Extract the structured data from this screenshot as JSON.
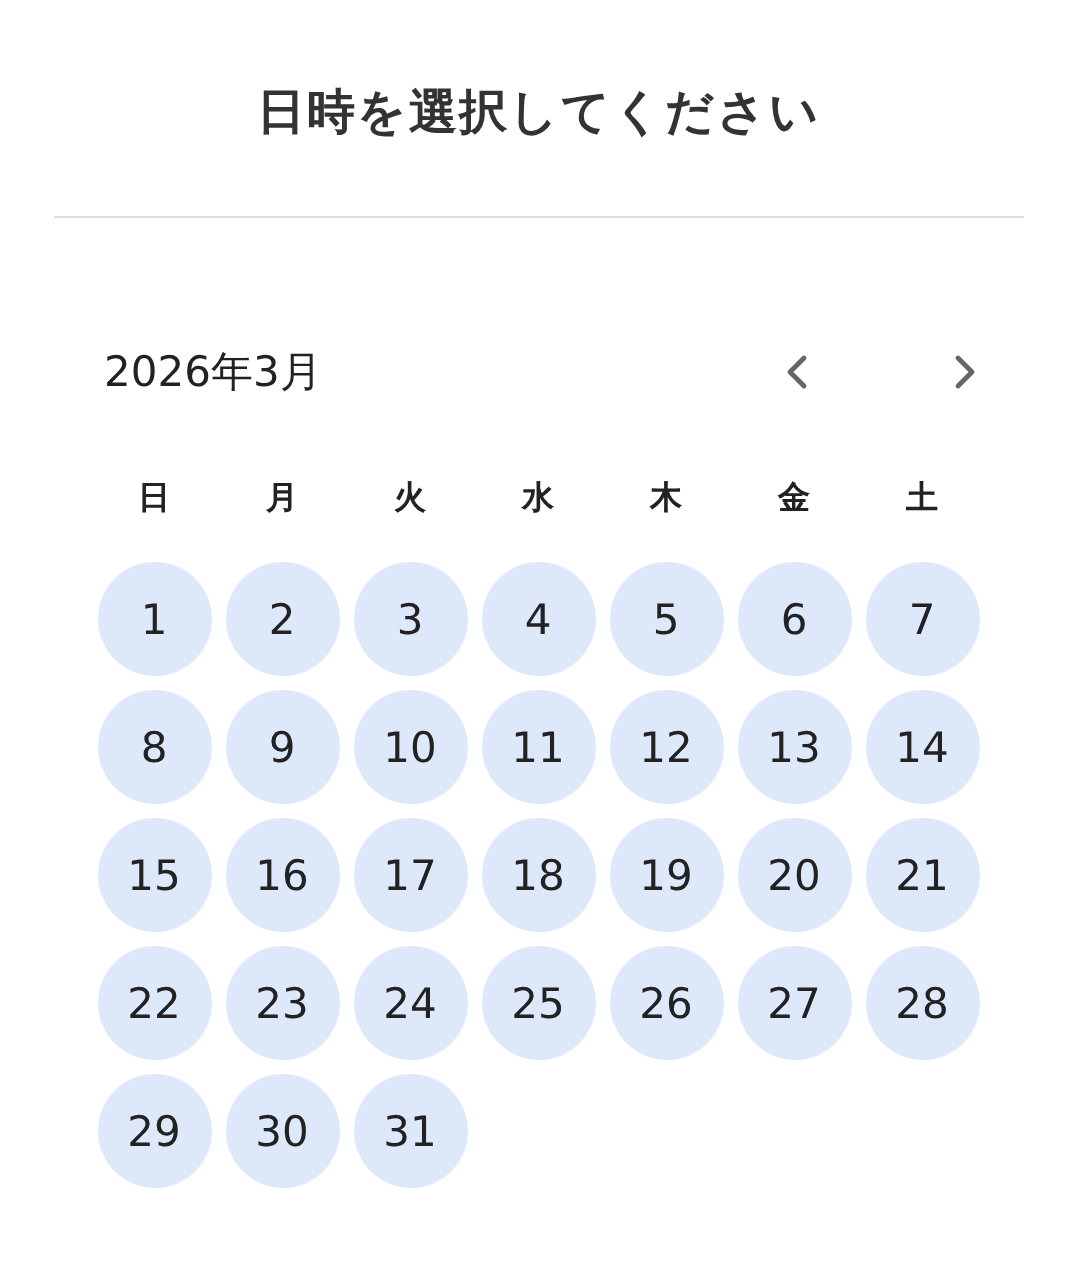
{
  "title": "日時を選択してください",
  "calendar": {
    "month_label": "2026年3月",
    "weekdays": [
      "日",
      "月",
      "火",
      "水",
      "木",
      "金",
      "土"
    ],
    "days": [
      "1",
      "2",
      "3",
      "4",
      "5",
      "6",
      "7",
      "8",
      "9",
      "10",
      "11",
      "12",
      "13",
      "14",
      "15",
      "16",
      "17",
      "18",
      "19",
      "20",
      "21",
      "22",
      "23",
      "24",
      "25",
      "26",
      "27",
      "28",
      "29",
      "30",
      "31"
    ]
  }
}
